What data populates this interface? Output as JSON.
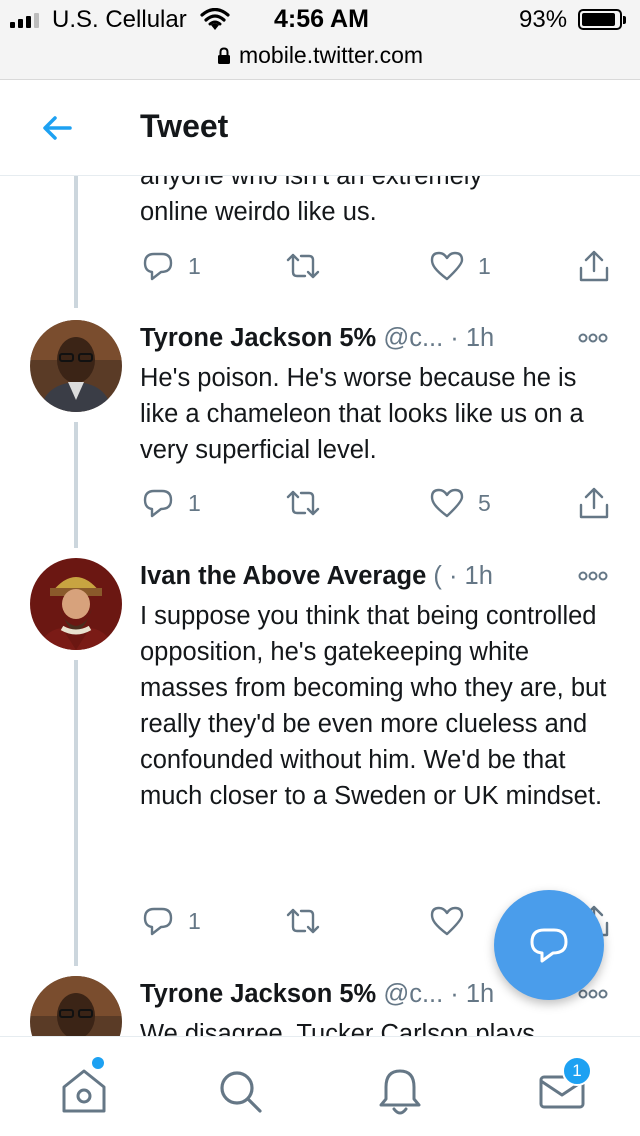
{
  "status_bar": {
    "carrier": "U.S. Cellular",
    "time": "4:56 AM",
    "battery_percent": "93%",
    "battery_level": 0.93,
    "url": "mobile.twitter.com"
  },
  "header": {
    "title": "Tweet",
    "back_icon": "arrow-left-icon"
  },
  "tweets": [
    {
      "text_lines": [
        "anyone who isn't an extremely",
        "online weirdo like us."
      ],
      "reply_count": "1",
      "retweet_count": "",
      "like_count": "1"
    },
    {
      "name": "Tyrone Jackson 5%",
      "handle": "@c...",
      "time": "· 1h",
      "text": "He's poison. He's worse because he is like a chameleon that looks like us on a very superficial level.",
      "reply_count": "1",
      "retweet_count": "",
      "like_count": "5"
    },
    {
      "name": "Ivan the Above Average",
      "handle": "(",
      "time": "· 1h",
      "text": "I suppose you think that being controlled opposition, he's gatekeeping white masses from becoming who they are, but really they'd be even more clueless and confounded without him. We'd be that much closer to a Sweden or UK mindset.",
      "reply_count": "1",
      "retweet_count": "",
      "like_count": ""
    },
    {
      "name": "Tyrone Jackson 5%",
      "handle": "@c...",
      "time": "· 1h",
      "text": "We disagree. Tucker Carlson plays"
    }
  ],
  "fab": {
    "icon": "compose-reply-icon"
  },
  "bottom_nav": {
    "items": [
      {
        "icon": "home-icon",
        "has_dot": true
      },
      {
        "icon": "search-icon"
      },
      {
        "icon": "notifications-bell-icon"
      },
      {
        "icon": "messages-envelope-icon",
        "badge": "1"
      }
    ]
  },
  "colors": {
    "accent": "#1da1f2",
    "fab": "#4a9deb",
    "secondary_text": "#657786",
    "thread_line": "#ccd6dd"
  }
}
